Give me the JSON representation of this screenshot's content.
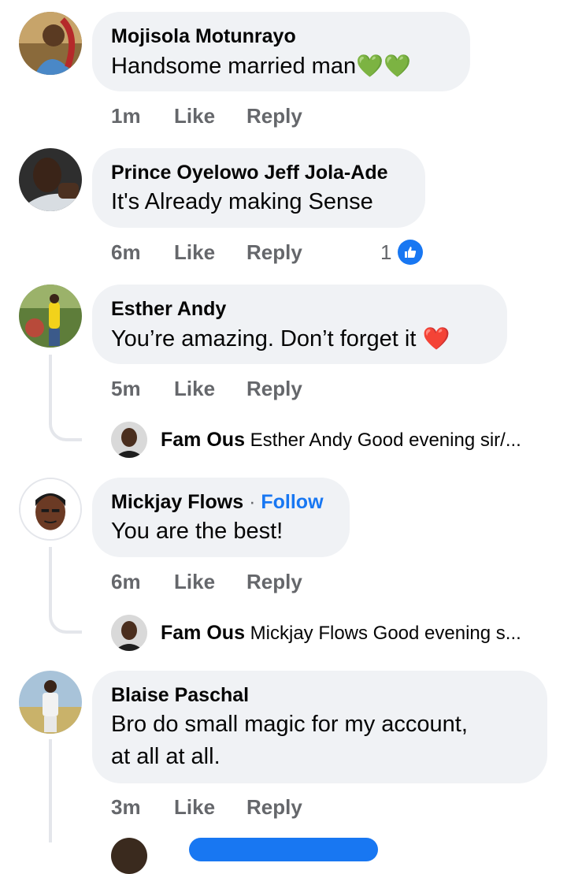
{
  "comments": [
    {
      "author": "Mojisola Motunrayo",
      "text": "Handsome married man",
      "emoji": "💚💚",
      "time": "1m",
      "like_label": "Like",
      "reply_label": "Reply"
    },
    {
      "author": "Prince Oyelowo Jeff Jola-Ade",
      "text": "It's Already making Sense",
      "time": "6m",
      "like_label": "Like",
      "reply_label": "Reply",
      "reaction_count": "1"
    },
    {
      "author": "Esther Andy",
      "text": "You’re amazing. Don’t forget it",
      "emoji": "❤️",
      "time": "5m",
      "like_label": "Like",
      "reply_label": "Reply",
      "reply_preview": {
        "author": "Fam Ous",
        "text": "Esther Andy Good evening sir/..."
      }
    },
    {
      "author": "Mickjay Flows",
      "separator": "·",
      "follow_label": "Follow",
      "text": "You are the best!",
      "time": "6m",
      "like_label": "Like",
      "reply_label": "Reply",
      "reply_preview": {
        "author": "Fam Ous",
        "text": "Mickjay Flows Good evening s..."
      }
    },
    {
      "author": "Blaise Paschal",
      "text_line1": "Bro do small magic for my account,",
      "text_line2": "at all at all.",
      "time": "3m",
      "like_label": "Like",
      "reply_label": "Reply"
    }
  ],
  "colors": {
    "bubble": "#f0f2f5",
    "meta_text": "#65676b",
    "accent": "#1877f2",
    "thread_line": "#e4e6eb"
  }
}
